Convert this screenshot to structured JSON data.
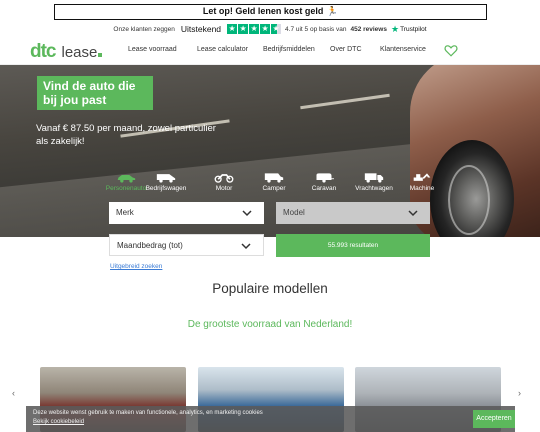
{
  "warning": {
    "text": "Let op! Geld lenen kost geld",
    "icon": "running-person-icon"
  },
  "trustpilot": {
    "prefix": "Onze klanten zeggen",
    "rating_word": "Uitstekend",
    "stars": 4.5,
    "score_text": "4.7 uit 5 op basis van",
    "reviews_count": "452 reviews",
    "brand": "Trustpilot",
    "star_color": "#00b67a"
  },
  "nav": {
    "logo_main": "dtc",
    "logo_sub": "lease",
    "items": [
      "Lease voorraad",
      "Lease calculator",
      "Bedrijfsmiddelen",
      "Over DTC",
      "Klantenservice"
    ],
    "favorites_icon": "heart-icon"
  },
  "hero": {
    "title": "Vind de auto die bij jou past",
    "subtitle": "Vanaf € 87.50 per maand, zowel particulier als zakelijk!"
  },
  "categories": [
    {
      "label": "Personenauto",
      "icon": "car-icon",
      "active": true
    },
    {
      "label": "Bedrijfswagen",
      "icon": "van-icon",
      "active": false
    },
    {
      "label": "Motor",
      "icon": "motorcycle-icon",
      "active": false
    },
    {
      "label": "Camper",
      "icon": "camper-icon",
      "active": false
    },
    {
      "label": "Caravan",
      "icon": "caravan-icon",
      "active": false
    },
    {
      "label": "Vrachtwagen",
      "icon": "truck-icon",
      "active": false
    },
    {
      "label": "Machine",
      "icon": "excavator-icon",
      "active": false
    }
  ],
  "search": {
    "merk": "Merk",
    "model": "Model",
    "maandbedrag": "Maandbedrag (tot)",
    "results_button": "55.993 resultaten",
    "advanced_link": "Uitgebreid zoeken"
  },
  "section": {
    "title": "Populaire modellen",
    "subtitle": "De grootste voorraad van Nederland!"
  },
  "carousel": {
    "prev": "‹",
    "next": "›"
  },
  "cookie": {
    "text": "Deze website wenst gebruik te maken van functionele, analytics, en marketing cookies",
    "link": "Bekijk cookiebeleid",
    "accept": "Accepteren"
  },
  "colors": {
    "brand_green": "#5cb85c",
    "link_blue": "#3a7bd5"
  }
}
